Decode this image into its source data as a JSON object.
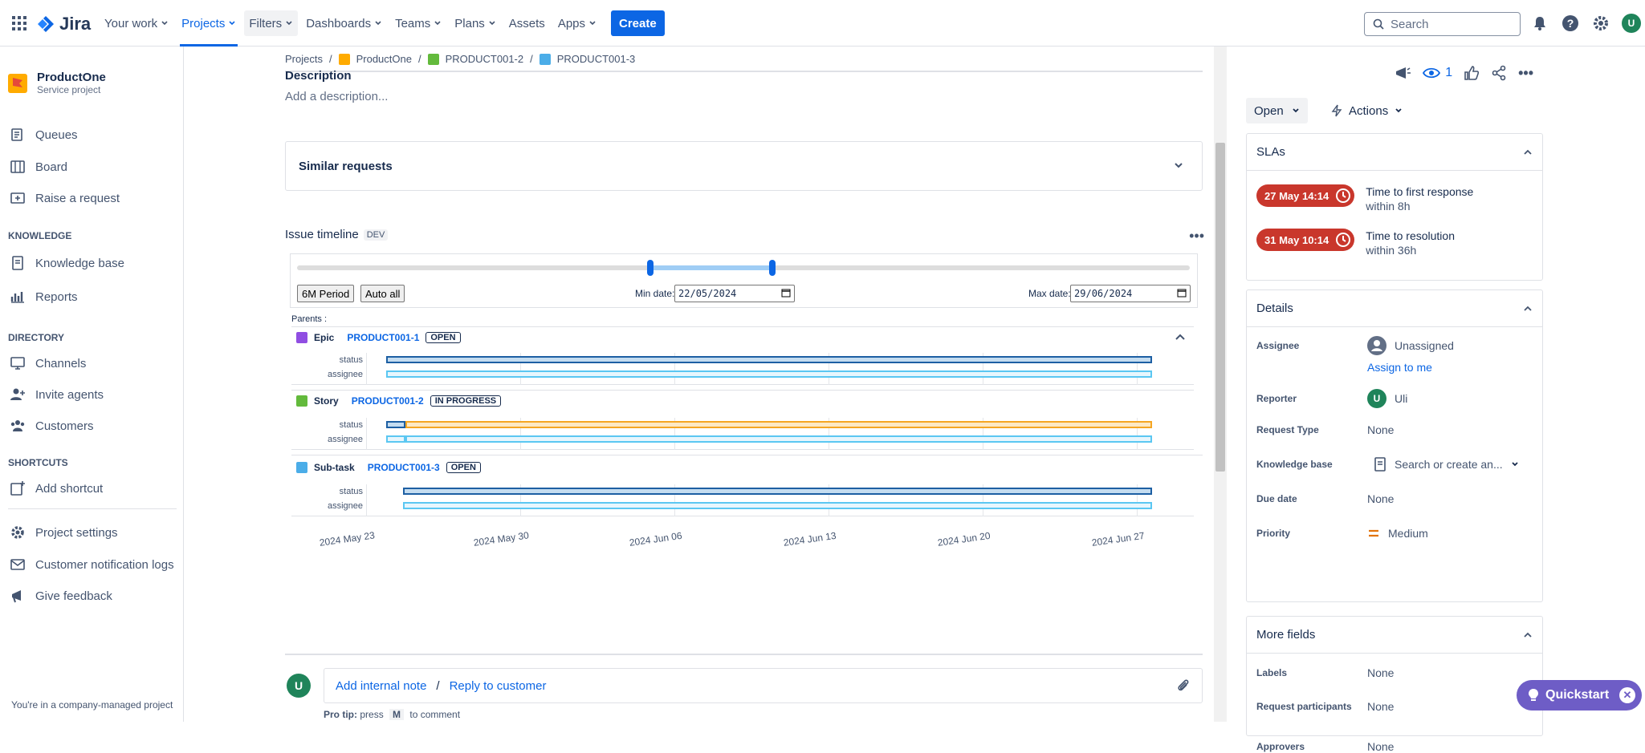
{
  "topbar": {
    "logo": "Jira",
    "nav": [
      "Your work",
      "Projects",
      "Filters",
      "Dashboards",
      "Teams",
      "Plans",
      "Assets",
      "Apps"
    ],
    "create": "Create",
    "search_placeholder": "Search",
    "avatar": "U"
  },
  "sidebar": {
    "project_name": "ProductOne",
    "project_type": "Service project",
    "items": [
      "Queues",
      "Board",
      "Raise a request"
    ],
    "knowledge_head": "KNOWLEDGE",
    "knowledge_items": [
      "Knowledge base",
      "Reports"
    ],
    "directory_head": "DIRECTORY",
    "directory_items": [
      "Channels",
      "Invite agents",
      "Customers"
    ],
    "shortcuts_head": "SHORTCUTS",
    "shortcuts_items": [
      "Add shortcut"
    ],
    "bottom_items": [
      "Project settings",
      "Customer notification logs",
      "Give feedback"
    ],
    "footer": "You're in a company-managed project"
  },
  "breadcrumb": [
    "Projects",
    "ProductOne",
    "PRODUCT001-2",
    "PRODUCT001-3"
  ],
  "description": {
    "label": "Description",
    "placeholder": "Add a description..."
  },
  "similar": "Similar requests",
  "timeline": {
    "title": "Issue timeline",
    "badge": "DEV",
    "btn_period": "6M Period",
    "btn_auto": "Auto all",
    "min_label": "Min date:",
    "min_value": [
      "22",
      "05",
      "2024"
    ],
    "max_label": "Max date:",
    "max_value": [
      "29",
      "06",
      "2024"
    ],
    "parents": "Parents :",
    "issues": [
      {
        "kind": "Epic",
        "key": "PRODUCT001-1",
        "status": "OPEN"
      },
      {
        "kind": "Story",
        "key": "PRODUCT001-2",
        "status": "IN PROGRESS"
      },
      {
        "kind": "Sub-task",
        "key": "PRODUCT001-3",
        "status": "OPEN"
      }
    ],
    "row_labels": [
      "status",
      "assignee"
    ],
    "axis": [
      "2024 May 23",
      "2024 May 30",
      "2024 Jun 06",
      "2024 Jun 13",
      "2024 Jun 20",
      "2024 Jun 27"
    ]
  },
  "comment": {
    "avatar": "U",
    "add_note": "Add internal note",
    "sep": "/",
    "reply": "Reply to customer",
    "protip_pre": "Pro tip:",
    "protip_press": "press",
    "protip_key": "M",
    "protip_post": "to comment"
  },
  "right": {
    "watch_count": "1",
    "status_btn": "Open",
    "actions": "Actions",
    "slas_title": "SLAs",
    "slas": [
      {
        "pill": "27 May 14:14",
        "title": "Time to first response",
        "sub": "within 8h"
      },
      {
        "pill": "31 May 10:14",
        "title": "Time to resolution",
        "sub": "within 36h"
      }
    ],
    "details_title": "Details",
    "assignee_k": "Assignee",
    "assignee_v": "Unassigned",
    "assign_me": "Assign to me",
    "reporter_k": "Reporter",
    "reporter_v": "Uli",
    "reporter_av": "U",
    "request_type_k": "Request Type",
    "request_type_v": "None",
    "kb_k": "Knowledge base",
    "kb_v": "Search or create an...",
    "due_k": "Due date",
    "due_v": "None",
    "priority_k": "Priority",
    "priority_v": "Medium",
    "more_title": "More fields",
    "labels_k": "Labels",
    "labels_v": "None",
    "participants_k": "Request participants",
    "participants_v": "None",
    "approvers_k": "Approvers",
    "approvers_v": "None"
  },
  "quickstart": "Quickstart",
  "colors": {
    "primary": "#0c66e4",
    "sla_red": "#c9372c",
    "bar_dark": "#1d5fa3",
    "bar_light": "#5bc7f2",
    "bar_orange": "#f5a623"
  }
}
